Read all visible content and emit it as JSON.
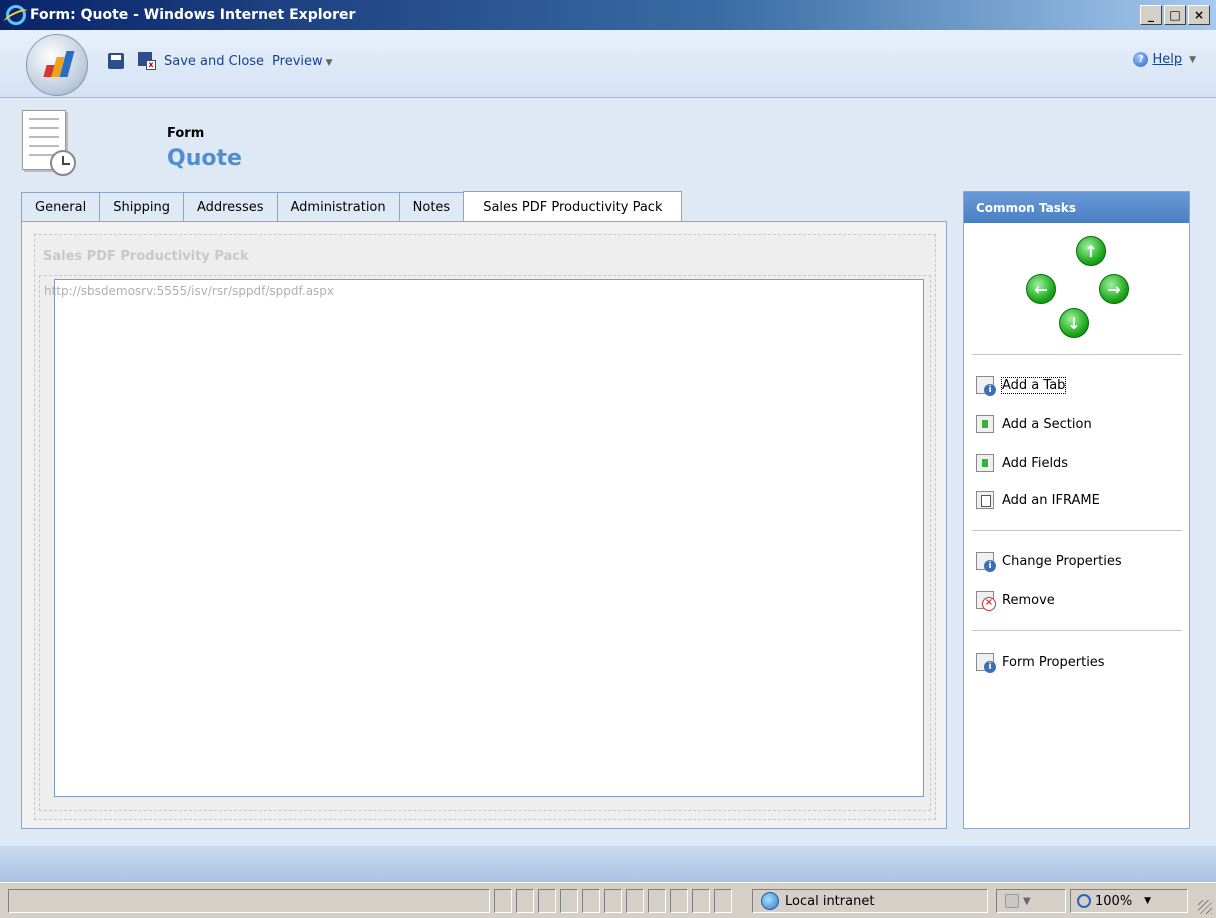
{
  "window": {
    "title": "Form: Quote - Windows Internet Explorer"
  },
  "toolbar": {
    "save_close_label": "Save and Close",
    "preview_label": "Preview",
    "help_label": "Help"
  },
  "header": {
    "subtitle": "Form",
    "title": "Quote"
  },
  "tabs": [
    {
      "label": "General"
    },
    {
      "label": "Shipping"
    },
    {
      "label": "Addresses"
    },
    {
      "label": "Administration"
    },
    {
      "label": "Notes"
    },
    {
      "label": "Sales PDF Productivity Pack",
      "active": true
    }
  ],
  "section": {
    "title": "Sales PDF Productivity Pack",
    "iframe_url": "http://sbsdemosrv:5555/isv/rsr/sppdf/sppdf.aspx"
  },
  "tasks": {
    "title": "Common Tasks",
    "group1": [
      {
        "label": "Add a Tab",
        "icon": "add-tab-icon"
      },
      {
        "label": "Add a Section",
        "icon": "add-section-icon"
      },
      {
        "label": "Add Fields",
        "icon": "add-fields-icon"
      },
      {
        "label": "Add an IFRAME",
        "icon": "add-iframe-icon"
      }
    ],
    "group2": [
      {
        "label": "Change Properties",
        "icon": "change-properties-icon"
      },
      {
        "label": "Remove",
        "icon": "remove-icon"
      }
    ],
    "group3": [
      {
        "label": "Form Properties",
        "icon": "form-properties-icon"
      }
    ]
  },
  "statusbar": {
    "zone": "Local intranet",
    "zoom": "100%"
  },
  "colors": {
    "accent": "#4f8fce",
    "tasks_header": "#4a7fc4",
    "nav_arrow": "#18a418"
  }
}
